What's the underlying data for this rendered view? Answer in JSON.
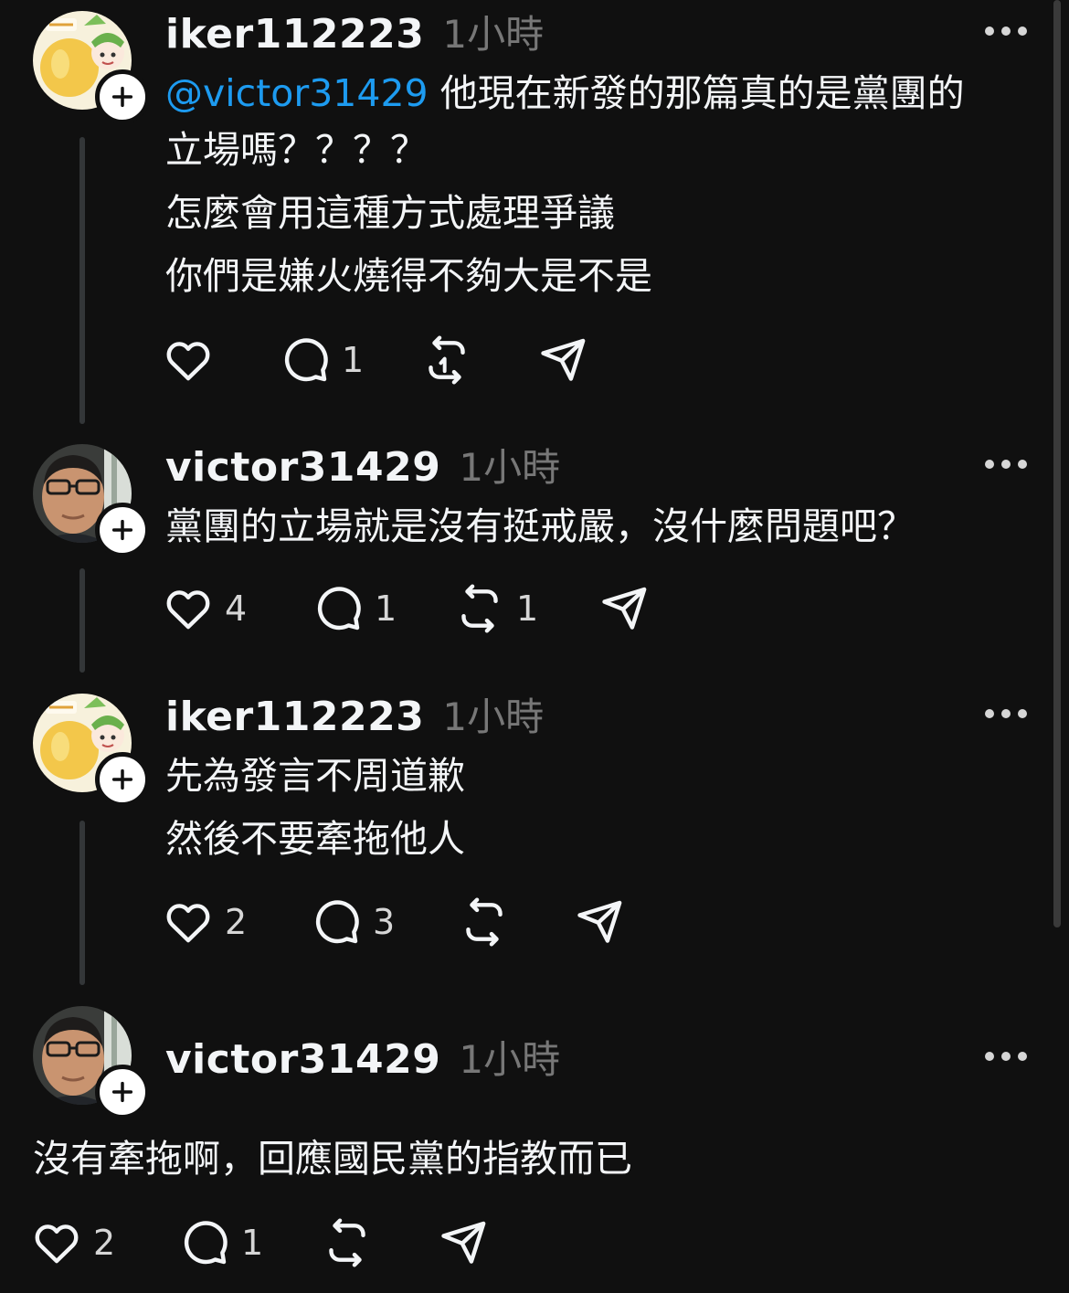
{
  "posts": [
    {
      "username": "iker112223",
      "time": "1小時",
      "mention": "@victor31429",
      "lines": [
        "他現在新發的那篇真的是黨團的",
        "立場嗎？？？？",
        "怎麼會用這種方式處理爭議",
        "你們是嫌火燒得不夠大是不是"
      ],
      "likes": "",
      "replies": "1",
      "reposts": ""
    },
    {
      "username": "victor31429",
      "time": "1小時",
      "lines": [
        "黨團的立場就是沒有挺戒嚴，沒什麼問題吧？"
      ],
      "likes": "4",
      "replies": "1",
      "reposts": "1"
    },
    {
      "username": "iker112223",
      "time": "1小時",
      "lines": [
        "先為發言不周道歉",
        "然後不要牽拖他人"
      ],
      "likes": "2",
      "replies": "3",
      "reposts": ""
    },
    {
      "username": "victor31429",
      "time": "1小時",
      "lines": [
        "沒有牽拖啊，回應國民黨的指教而已"
      ],
      "likes": "2",
      "replies": "1",
      "reposts": ""
    }
  ],
  "icons": {
    "like": "heart-icon",
    "reply": "comment-bubble-icon",
    "repost": "repost-icon",
    "share": "send-icon",
    "more": "more-icon",
    "follow": "plus-icon"
  },
  "colors": {
    "background": "#101010",
    "text": "#f3f5f7",
    "muted": "#777777",
    "mention": "#1d9bf0",
    "thread_line": "#333638"
  }
}
